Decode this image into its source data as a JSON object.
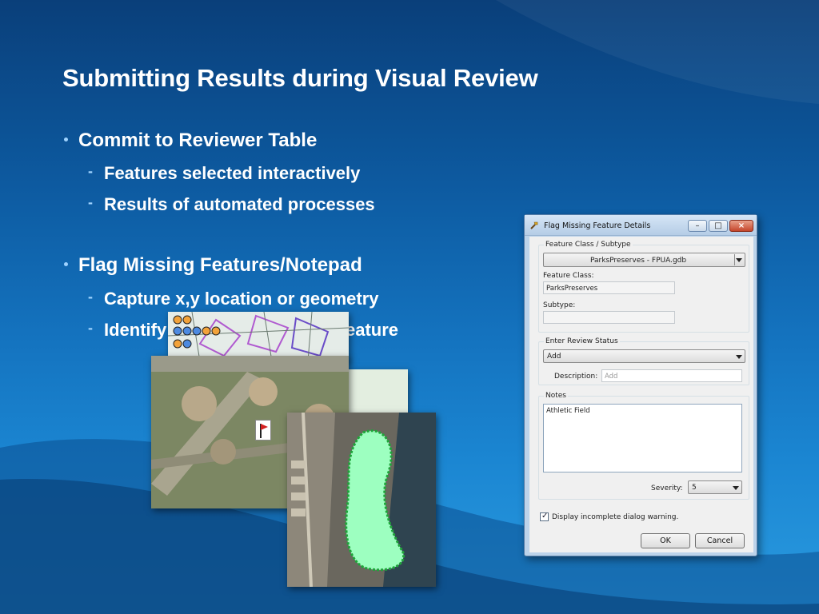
{
  "slide": {
    "title": "Submitting Results during Visual Review",
    "bullets": [
      {
        "text": "Commit to Reviewer Table",
        "subs": [
          "Features selected interactively",
          "Results of automated processes"
        ]
      },
      {
        "text": "Flag Missing Features/Notepad",
        "subs": [
          "Capture x,y location or geometry",
          "Identify",
          "eature"
        ]
      }
    ]
  },
  "dialog": {
    "title": "Flag Missing Feature Details",
    "window_buttons": {
      "minimize": "–",
      "maximize": "□",
      "close": "×"
    },
    "feature_class_group": {
      "label": "Feature Class / Subtype",
      "combo_value": "ParksPreserves - FPUA.gdb",
      "feature_class_label": "Feature Class:",
      "feature_class_value": "ParksPreserves",
      "subtype_label": "Subtype:",
      "subtype_value": ""
    },
    "review_status_group": {
      "label": "Enter Review Status",
      "status_value": "Add",
      "description_label": "Description:",
      "description_placeholder": "Add"
    },
    "notes_group": {
      "label": "Notes",
      "notes_value": "Athletic Field",
      "severity_label": "Severity:",
      "severity_value": "5"
    },
    "checkbox": {
      "label": "Display incomplete dialog warning.",
      "checked": true
    },
    "ok_label": "OK",
    "cancel_label": "Cancel"
  },
  "icons": [
    "flag-icon",
    "hammer-icon",
    "dropdown-arrow-icon",
    "checkmark-icon"
  ],
  "colors": {
    "background_top": "#0a3f7a",
    "background_bottom": "#2a9be0",
    "polygon_fill": "#9dffc0",
    "polygon_outline": "#1fa53a"
  }
}
